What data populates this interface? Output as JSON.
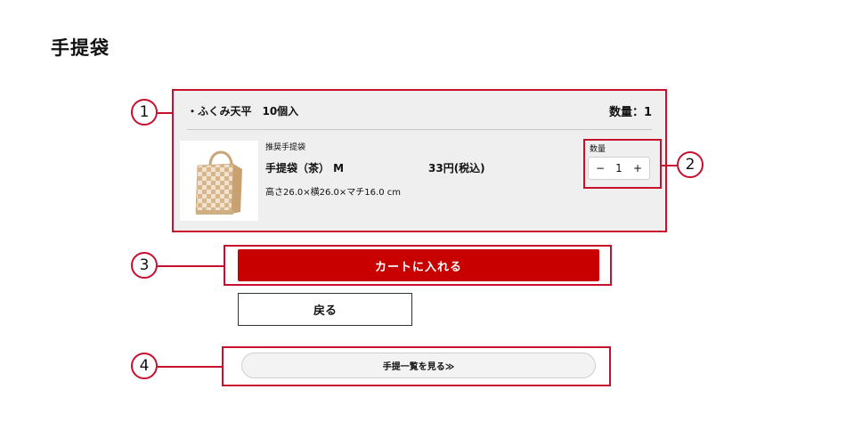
{
  "page": {
    "title": "手提袋"
  },
  "item": {
    "name": "・ふくみ天平　10個入",
    "quantity_text": "数量：1"
  },
  "product": {
    "recommend_label": "推奨手提袋",
    "name": "手提袋（茶） M",
    "price": "33円(税込)",
    "size": "高さ26.0×横26.0×マチ16.0 cm"
  },
  "stepper": {
    "label": "数量",
    "minus": "−",
    "value": "1",
    "plus": "+"
  },
  "buttons": {
    "cart": "カートに入れる",
    "back": "戻る",
    "list": "手提一覧を見る≫"
  },
  "annotations": {
    "one": "1",
    "two": "2",
    "three": "3",
    "four": "4"
  },
  "colors": {
    "accent_red": "#c80000",
    "annotation_red": "#c8102e",
    "card_bg": "#efefef"
  },
  "icons": {
    "product_image": "paper-bag-checkered"
  }
}
